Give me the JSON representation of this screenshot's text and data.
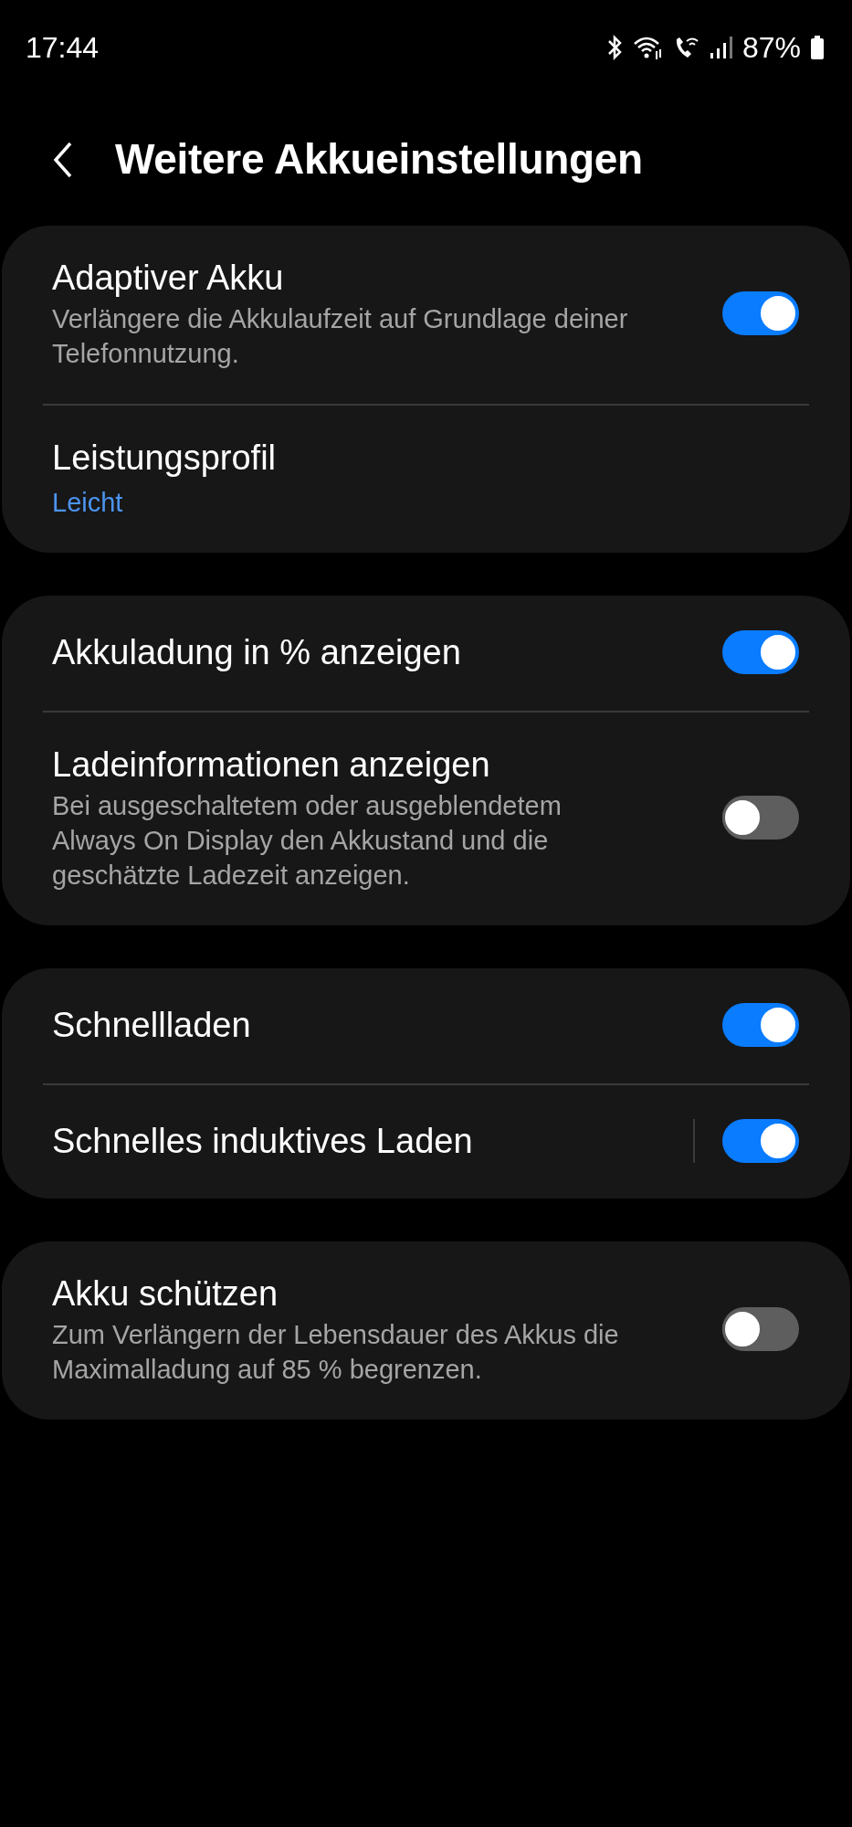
{
  "status_bar": {
    "time": "17:44",
    "battery": "87%"
  },
  "header": {
    "title": "Weitere Akkueinstellungen"
  },
  "groups": [
    {
      "items": [
        {
          "kind": "toggle",
          "title": "Adaptiver Akku",
          "subtitle": "Verlängere die Akkulaufzeit auf Grundlage deiner Telefonnutzung.",
          "on": true
        },
        {
          "kind": "value",
          "title": "Leistungsprofil",
          "value": "Leicht"
        }
      ]
    },
    {
      "items": [
        {
          "kind": "toggle",
          "title": "Akkuladung in % anzeigen",
          "on": true
        },
        {
          "kind": "toggle",
          "title": "Ladeinformationen anzeigen",
          "subtitle": "Bei ausgeschaltetem oder ausgeblendetem Always On Display den Akkustand und die geschätzte Ladezeit anzeigen.",
          "on": false
        }
      ]
    },
    {
      "items": [
        {
          "kind": "toggle",
          "title": "Schnellladen",
          "on": true
        },
        {
          "kind": "toggle",
          "title": "Schnelles induktives Laden",
          "on": true,
          "separator": true
        }
      ]
    },
    {
      "items": [
        {
          "kind": "toggle",
          "title": "Akku schützen",
          "subtitle": "Zum Verlängern der Lebensdauer des Akkus die Maximalladung auf 85 % begrenzen.",
          "on": false
        }
      ]
    }
  ]
}
